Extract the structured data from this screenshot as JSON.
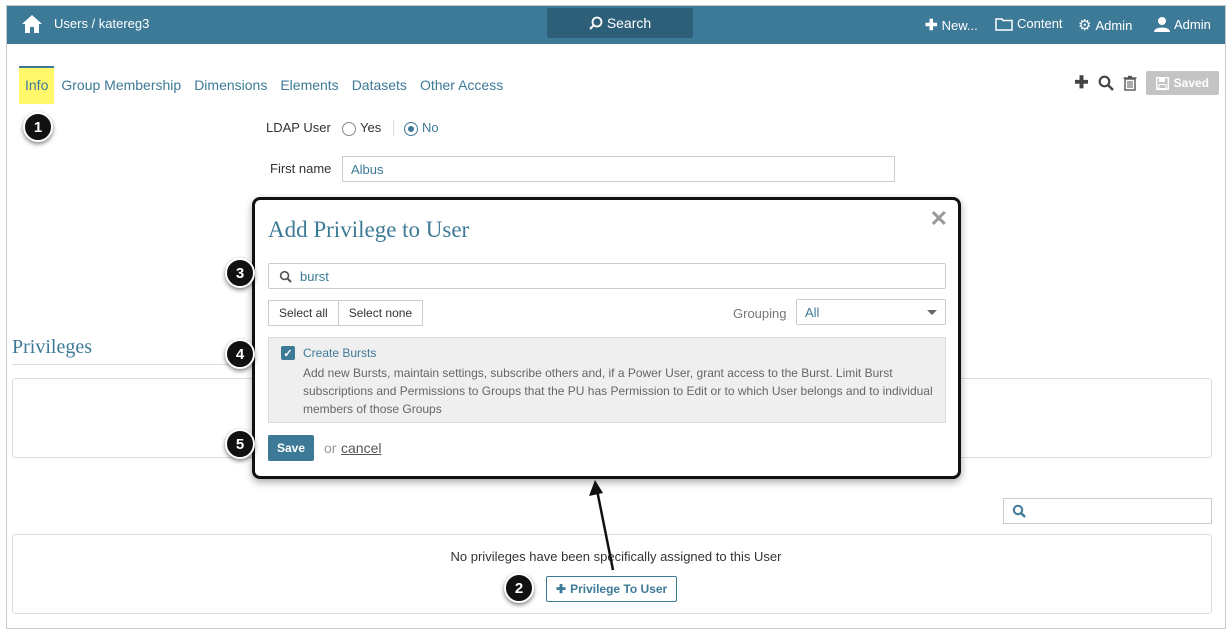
{
  "topbar": {
    "breadcrumb": "Users / katereg3",
    "search_label": "Search",
    "new_label": "New...",
    "content_label": "Content",
    "admin_label": "Admin",
    "user_label": "Admin"
  },
  "tabs": [
    {
      "label": "Info",
      "active": true
    },
    {
      "label": "Group Membership"
    },
    {
      "label": "Dimensions"
    },
    {
      "label": "Elements"
    },
    {
      "label": "Datasets"
    },
    {
      "label": "Other Access"
    }
  ],
  "toolbar": {
    "saved_label": "Saved"
  },
  "form": {
    "ldap_label": "LDAP User",
    "ldap_yes": "Yes",
    "ldap_no": "No",
    "first_name_label": "First name",
    "first_name_value": "Albus"
  },
  "privileges": {
    "title": "Privileges",
    "empty_text": "No privileges have been specifically assigned to this User",
    "add_button": "Privilege To User"
  },
  "modal": {
    "title": "Add Privilege to User",
    "search_value": "burst",
    "select_all": "Select all",
    "select_none": "Select none",
    "grouping_label": "Grouping",
    "grouping_value": "All",
    "item_name": "Create Bursts",
    "item_desc_line1": "Add new Bursts, maintain settings, subscribe others and, if a Power User, grant access to the Burst. Limit Burst",
    "item_desc_line2": "subscriptions and Permissions to Groups that the PU has Permission to Edit or to which User belongs and to individual",
    "item_desc_line3": "members of those Groups",
    "save_label": "Save",
    "or_text": "or",
    "cancel_label": "cancel"
  },
  "callouts": [
    "1",
    "2",
    "3",
    "4",
    "5"
  ],
  "colors": {
    "accent": "#3d7a97",
    "active_tab": "#fff86a"
  }
}
